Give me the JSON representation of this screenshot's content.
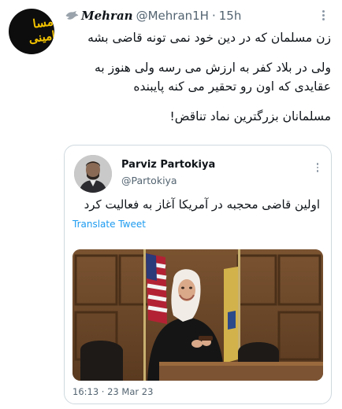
{
  "tweet": {
    "avatar_text": "مسا امینی",
    "author_name": "Mehran",
    "author_handle": "@Mehran1H",
    "separator": "·",
    "time": "15h",
    "lines": [
      "زن مسلمان که در دین خود نمی تونه قاضی بشه",
      "ولی در بلاد کفر به ارزش می رسه ولی هنوز به",
      "عقایدی که اون رو تحقیر می کنه پایبنده",
      "مسلمانان بزرگترین نماد تناقض!"
    ]
  },
  "quote": {
    "author_name": "Parviz Partokiya",
    "author_handle": "@Partokiya",
    "text": "اولین قاضی محجبه در آمریکا آغاز به فعالیت کرد",
    "translate_label": "Translate Tweet",
    "timestamp": "16:13 · 23 Mar 23"
  },
  "colors": {
    "text": "#0f1419",
    "secondary": "#536471",
    "link": "#1d9bf0",
    "border": "#cfd9de"
  },
  "icons": [
    "bird-icon",
    "more-options-icon"
  ]
}
